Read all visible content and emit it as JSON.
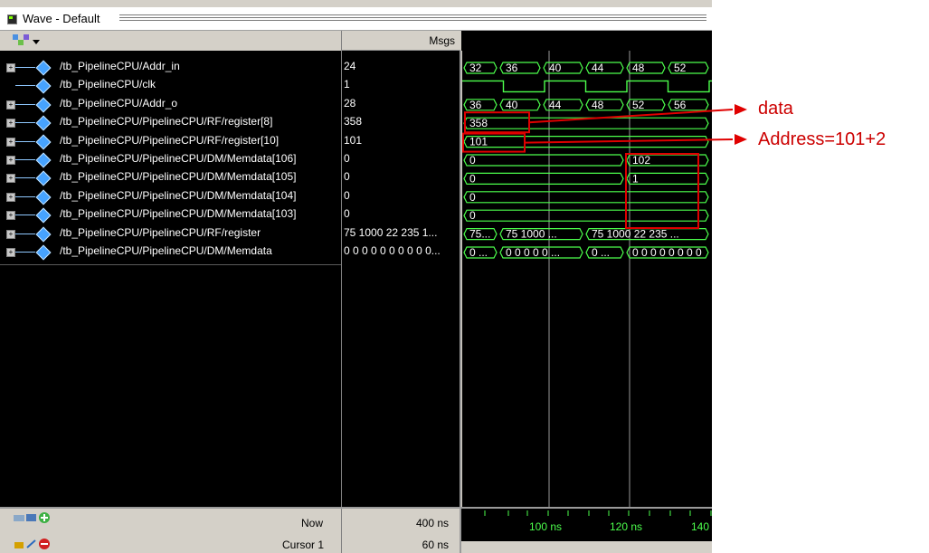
{
  "window": {
    "title": "Wave - Default"
  },
  "columns": {
    "msgs": "Msgs"
  },
  "signals": [
    {
      "path": "/tb_PipelineCPU/Addr_in",
      "value": "24",
      "expandable": true
    },
    {
      "path": "/tb_PipelineCPU/clk",
      "value": "1",
      "expandable": false
    },
    {
      "path": "/tb_PipelineCPU/Addr_o",
      "value": "28",
      "expandable": true
    },
    {
      "path": "/tb_PipelineCPU/PipelineCPU/RF/register[8]",
      "value": "358",
      "expandable": true
    },
    {
      "path": "/tb_PipelineCPU/PipelineCPU/RF/register[10]",
      "value": "101",
      "expandable": true
    },
    {
      "path": "/tb_PipelineCPU/PipelineCPU/DM/Memdata[106]",
      "value": "0",
      "expandable": true
    },
    {
      "path": "/tb_PipelineCPU/PipelineCPU/DM/Memdata[105]",
      "value": "0",
      "expandable": true
    },
    {
      "path": "/tb_PipelineCPU/PipelineCPU/DM/Memdata[104]",
      "value": "0",
      "expandable": true
    },
    {
      "path": "/tb_PipelineCPU/PipelineCPU/DM/Memdata[103]",
      "value": "0",
      "expandable": true
    },
    {
      "path": "/tb_PipelineCPU/PipelineCPU/RF/register",
      "value": "75 1000 22 235 1...",
      "expandable": true
    },
    {
      "path": "/tb_PipelineCPU/PipelineCPU/DM/Memdata",
      "value": "0 0 0 0 0 0 0 0 0 0...",
      "expandable": true
    }
  ],
  "waveforms": [
    {
      "kind": "bus",
      "segments": [
        {
          "start": 0,
          "end": 40,
          "label": "32"
        },
        {
          "start": 40,
          "end": 88,
          "label": "36"
        },
        {
          "start": 88,
          "end": 135,
          "label": "40"
        },
        {
          "start": 135,
          "end": 180,
          "label": "44"
        },
        {
          "start": 180,
          "end": 226,
          "label": "48"
        },
        {
          "start": 226,
          "end": 274,
          "label": "52"
        }
      ]
    },
    {
      "kind": "clock",
      "period": 91,
      "high_start": 0,
      "duty": 0.5,
      "phase": 0
    },
    {
      "kind": "bus",
      "segments": [
        {
          "start": 0,
          "end": 40,
          "label": "36"
        },
        {
          "start": 40,
          "end": 88,
          "label": "40"
        },
        {
          "start": 88,
          "end": 135,
          "label": "44"
        },
        {
          "start": 135,
          "end": 180,
          "label": "48"
        },
        {
          "start": 180,
          "end": 226,
          "label": "52"
        },
        {
          "start": 226,
          "end": 274,
          "label": "56"
        }
      ]
    },
    {
      "kind": "bus",
      "segments": [
        {
          "start": 0,
          "end": 274,
          "label": "358"
        }
      ]
    },
    {
      "kind": "bus",
      "segments": [
        {
          "start": 0,
          "end": 274,
          "label": "101"
        }
      ]
    },
    {
      "kind": "bus",
      "segments": [
        {
          "start": 0,
          "end": 180,
          "label": "0"
        },
        {
          "start": 180,
          "end": 274,
          "label": "102"
        }
      ]
    },
    {
      "kind": "bus",
      "segments": [
        {
          "start": 0,
          "end": 180,
          "label": "0"
        },
        {
          "start": 180,
          "end": 274,
          "label": "1"
        }
      ]
    },
    {
      "kind": "bus",
      "segments": [
        {
          "start": 0,
          "end": 274,
          "label": "0"
        }
      ]
    },
    {
      "kind": "bus",
      "segments": [
        {
          "start": 0,
          "end": 274,
          "label": "0"
        }
      ]
    },
    {
      "kind": "bus",
      "segments": [
        {
          "start": 0,
          "end": 40,
          "label": "75..."
        },
        {
          "start": 40,
          "end": 135,
          "label": "75 1000 ..."
        },
        {
          "start": 135,
          "end": 274,
          "label": "75 1000 22 235 ..."
        }
      ]
    },
    {
      "kind": "bus",
      "segments": [
        {
          "start": 0,
          "end": 40,
          "label": "0 ..."
        },
        {
          "start": 40,
          "end": 135,
          "label": "0 0 0 0 0 ..."
        },
        {
          "start": 135,
          "end": 180,
          "label": "0 ..."
        },
        {
          "start": 180,
          "end": 274,
          "label": "0 0 0 0 0 0 0 0"
        }
      ]
    }
  ],
  "timeline": {
    "ticks": [
      "100 ns",
      "120 ns",
      "140"
    ]
  },
  "status": {
    "now_label": "Now",
    "now_value": "400 ns",
    "cursor_label": "Cursor 1",
    "cursor_value": "60 ns"
  },
  "annotations": {
    "data": "data",
    "address": "Address=101+2"
  },
  "colors": {
    "wave": "#4cff4c",
    "highlight": "#e00000",
    "background": "#000000"
  }
}
